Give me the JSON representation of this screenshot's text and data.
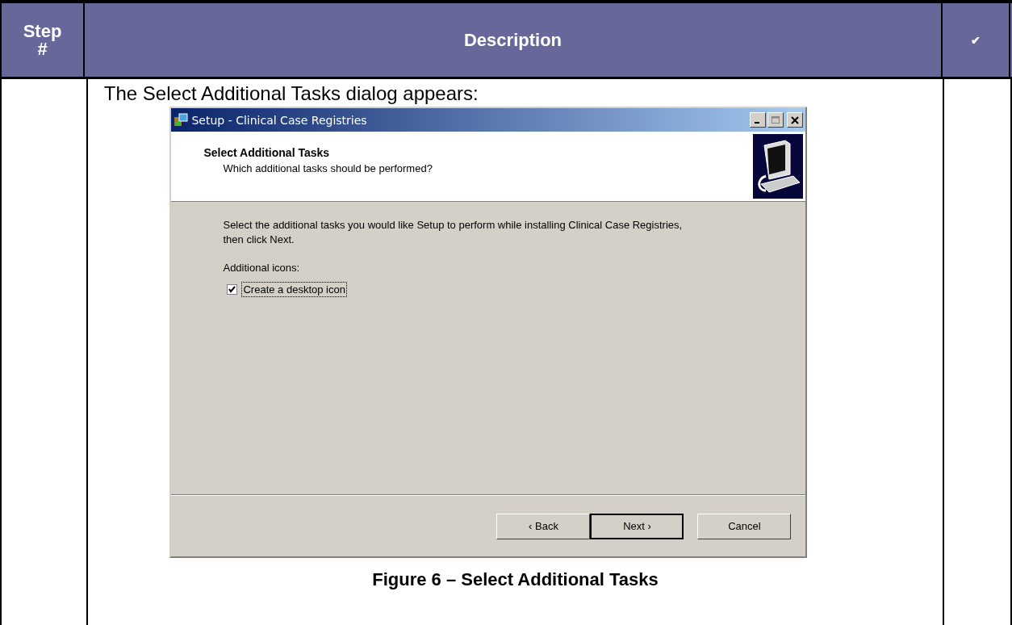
{
  "table": {
    "columns": [
      {
        "label": "Step #"
      },
      {
        "label": "Description"
      },
      {
        "label": "✔"
      }
    ],
    "row": {
      "intro": "The Select Additional Tasks dialog appears:",
      "dialog": {
        "title": "Setup - Clinical Case Registries",
        "header": {
          "title": "Select Additional Tasks",
          "subtitle": "Which additional tasks should be performed?"
        },
        "instructions": "Select the additional tasks you would like Setup to perform while installing Clinical Case Registries, then click Next.",
        "group_label": "Additional icons:",
        "checkbox": {
          "label": "Create a desktop icon",
          "checked": true
        },
        "buttons": [
          {
            "label": "‹ Back",
            "default": false
          },
          {
            "label": "Next ›",
            "default": true
          },
          {
            "label": "Cancel",
            "default": false
          }
        ]
      },
      "caption": "Figure 6 – Select Additional Tasks"
    }
  }
}
